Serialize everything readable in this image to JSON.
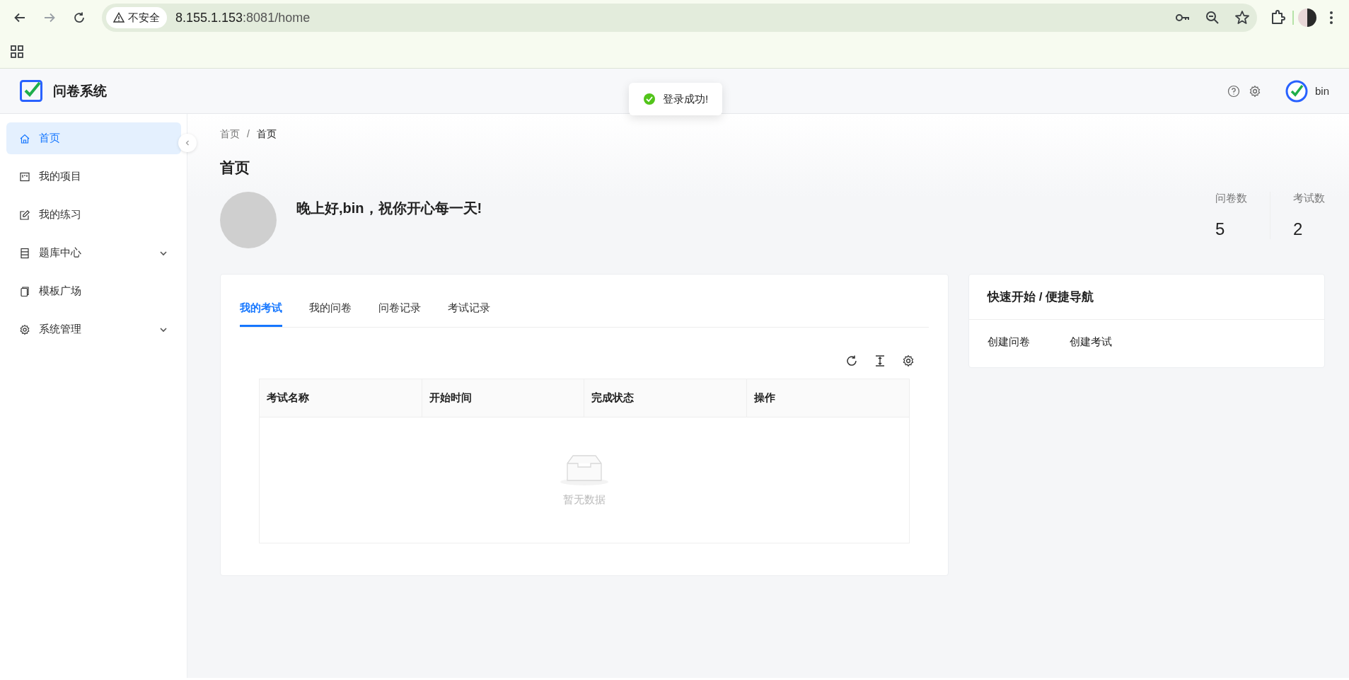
{
  "browser": {
    "security_label": "不安全",
    "url_host": "8.155.1.153",
    "url_path": ":8081/home",
    "forward_disabled": true
  },
  "header": {
    "app_name": "问卷系统",
    "user_name": "bin"
  },
  "toast": {
    "message": "登录成功!"
  },
  "sidebar": {
    "items": [
      {
        "kind": "link",
        "label": "首页",
        "selected": true
      },
      {
        "kind": "link",
        "label": "我的项目",
        "selected": false
      },
      {
        "kind": "link",
        "label": "我的练习",
        "selected": false
      },
      {
        "kind": "group",
        "label": "题库中心",
        "selected": false,
        "expanded": false
      },
      {
        "kind": "link",
        "label": "模板广场",
        "selected": false
      },
      {
        "kind": "group",
        "label": "系统管理",
        "selected": false,
        "expanded": false
      }
    ]
  },
  "breadcrumb": {
    "items": [
      "首页",
      "首页"
    ],
    "separator": "/"
  },
  "page_title": "首页",
  "greeting": "晚上好,bin，祝你开心每一天!",
  "stats": [
    {
      "label": "问卷数",
      "value": "5"
    },
    {
      "label": "考试数",
      "value": "2"
    }
  ],
  "tabs": [
    {
      "label": "我的考试",
      "selected": true
    },
    {
      "label": "我的问卷",
      "selected": false
    },
    {
      "label": "问卷记录",
      "selected": false
    },
    {
      "label": "考试记录",
      "selected": false
    }
  ],
  "table": {
    "columns": [
      "考试名称",
      "开始时间",
      "完成状态",
      "操作"
    ],
    "empty_text": "暂无数据"
  },
  "quick_nav": {
    "title": "快速开始 / 便捷导航",
    "links": [
      "创建问卷",
      "创建考试"
    ]
  }
}
